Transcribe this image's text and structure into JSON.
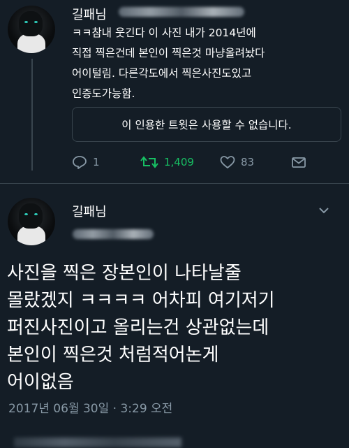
{
  "tweet1": {
    "display_name": "길패님",
    "text": "ㅋㅋ참내 웃긴다 이 사진 내가 2014년에\n직접 찍은건데 본인이 찍은것 마냥올려놨다\n어이털림. 다른각도에서 찍은사진도있고\n인증도가능함.",
    "quoted_unavailable": "이 인용한 트윗은 사용할 수 없습니다.",
    "reply_count": "1",
    "retweet_count": "1,409",
    "like_count": "83",
    "icons": {
      "reply": "reply-icon",
      "retweet": "retweet-icon",
      "like": "heart-icon",
      "share": "share-icon"
    }
  },
  "tweet2": {
    "display_name": "길패님",
    "text": "사진을 찍은 장본인이 나타날줄\n몰랐겠지 ㅋㅋㅋㅋ 어차피 여기저기\n퍼진사진이고 올리는건 상관없는데\n본인이 찍은것 처럼적어논게\n어이없음",
    "timestamp": "2017년 06월 30일 · 3:29 오전"
  },
  "colors": {
    "background": "#141d26",
    "text": "#ffffff",
    "muted": "#8899a6",
    "retweet_active": "#17bf63",
    "border": "#38444d"
  }
}
